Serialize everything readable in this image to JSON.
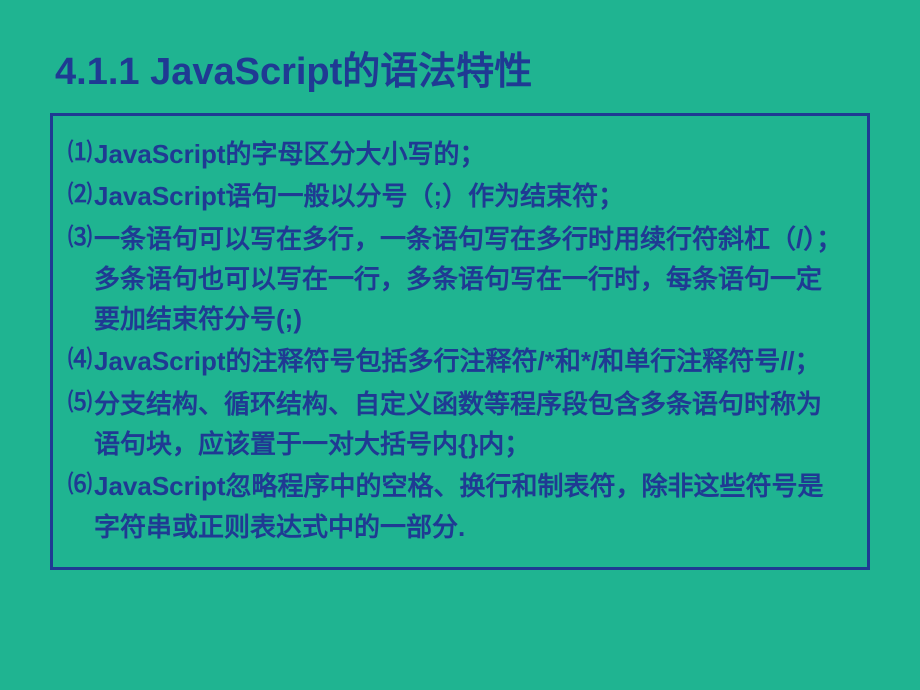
{
  "title": "4.1.1  JavaScript的语法特性",
  "items": [
    {
      "marker": "⑴",
      "text": "JavaScript的字母区分大小写的；"
    },
    {
      "marker": "⑵",
      "text": "JavaScript语句一般以分号（;）作为结束符；"
    },
    {
      "marker": "⑶",
      "text": "一条语句可以写在多行，一条语句写在多行时用续行符斜杠（/）；多条语句也可以写在一行，多条语句写在一行时，每条语句一定要加结束符分号(;)"
    },
    {
      "marker": "⑷",
      "text": "JavaScript的注释符号包括多行注释符/*和*/和单行注释符号//；"
    },
    {
      "marker": "⑸",
      "text": "分支结构、循环结构、自定义函数等程序段包含多条语句时称为语句块，应该置于一对大括号内{}内；"
    },
    {
      "marker": "⑹",
      "text": "JavaScript忽略程序中的空格、换行和制表符，除非这些符号是字符串或正则表达式中的一部分."
    }
  ]
}
